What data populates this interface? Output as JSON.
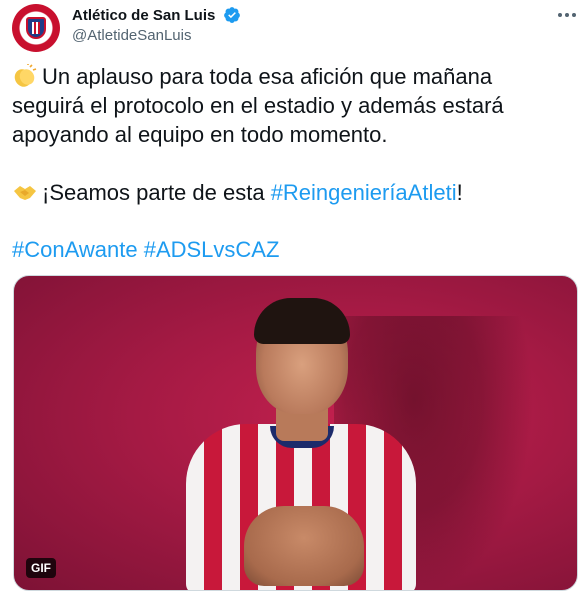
{
  "account": {
    "display_name": "Atlético de San Luis",
    "handle": "@AtletideSanLuis"
  },
  "tweet": {
    "paragraph1_line1": "Un aplauso para toda esa afición que mañana",
    "paragraph1_line2": "seguirá el protocolo en el estadio y además estará",
    "paragraph1_line3": "apoyando al equipo en todo momento.",
    "paragraph2_text": "¡Seamos parte de esta ",
    "paragraph2_hashtag": "#ReingenieríaAtleti",
    "paragraph2_end": "!",
    "hashtag1": "#ConAwante",
    "hashtag2": "#ADSLvsCAZ"
  },
  "media": {
    "badge": "GIF"
  },
  "colors": {
    "link": "#1d9bf0",
    "text": "#0f1419",
    "secondary": "#536471",
    "verified": "#1d9bf0"
  }
}
